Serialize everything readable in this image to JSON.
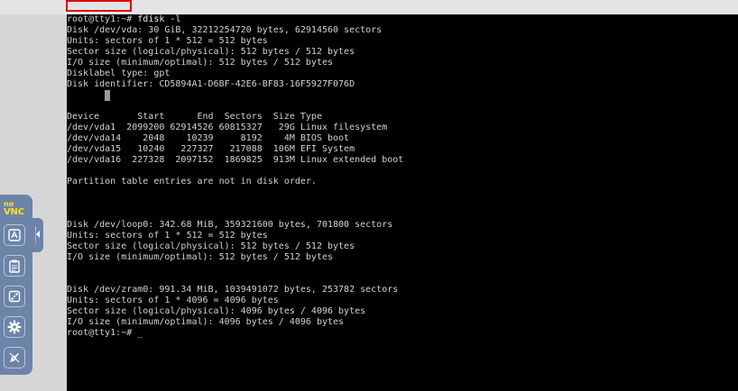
{
  "terminal": {
    "lines": [
      {
        "segments": [
          {
            "text": "root@tty1:",
            "cls": "prompt-user"
          },
          {
            "text": "~#",
            "cls": "prompt-tilde"
          },
          {
            "text": " fdisk -l",
            "cls": "cmd-text"
          }
        ]
      },
      {
        "segments": [
          {
            "text": "Disk /dev/vda: 30 GiB, 32212254720 bytes, 62914560 sectors"
          }
        ]
      },
      {
        "segments": [
          {
            "text": "Units: sectors of 1 * 512 = 512 bytes"
          }
        ]
      },
      {
        "segments": [
          {
            "text": "Sector size (logical/physical): 512 bytes / 512 bytes"
          }
        ]
      },
      {
        "segments": [
          {
            "text": "I/O size (minimum/optimal): 512 bytes / 512 bytes"
          }
        ]
      },
      {
        "segments": [
          {
            "text": "Disklabel type: gpt"
          }
        ]
      },
      {
        "segments": [
          {
            "text": "Disk identifier: CD5894A1-D6BF-42E6-BF83-16F5927F076D"
          }
        ]
      },
      {
        "segments": [
          {
            "text": ""
          }
        ]
      },
      {
        "segments": [
          {
            "text": ""
          }
        ]
      },
      {
        "segments": [
          {
            "text": "Device       Start      End  Sectors  Size Type"
          }
        ]
      },
      {
        "segments": [
          {
            "text": "/dev/vda1  2099200 62914526 60815327   29G Linux filesystem"
          }
        ]
      },
      {
        "segments": [
          {
            "text": "/dev/vda14    2048    10239     8192    4M BIOS boot"
          }
        ]
      },
      {
        "segments": [
          {
            "text": "/dev/vda15   10240   227327   217088  106M EFI System"
          }
        ]
      },
      {
        "segments": [
          {
            "text": "/dev/vda16  227328  2097152  1869825  913M Linux extended boot"
          }
        ]
      },
      {
        "segments": [
          {
            "text": ""
          }
        ]
      },
      {
        "segments": [
          {
            "text": "Partition table entries are not in disk order."
          }
        ]
      },
      {
        "segments": [
          {
            "text": ""
          }
        ]
      },
      {
        "segments": [
          {
            "text": ""
          }
        ]
      },
      {
        "segments": [
          {
            "text": ""
          }
        ]
      },
      {
        "segments": [
          {
            "text": "Disk /dev/loop0: 342.68 MiB, 359321600 bytes, 701800 sectors"
          }
        ]
      },
      {
        "segments": [
          {
            "text": "Units: sectors of 1 * 512 = 512 bytes"
          }
        ]
      },
      {
        "segments": [
          {
            "text": "Sector size (logical/physical): 512 bytes / 512 bytes"
          }
        ]
      },
      {
        "segments": [
          {
            "text": "I/O size (minimum/optimal): 512 bytes / 512 bytes"
          }
        ]
      },
      {
        "segments": [
          {
            "text": ""
          }
        ]
      },
      {
        "segments": [
          {
            "text": ""
          }
        ]
      },
      {
        "segments": [
          {
            "text": "Disk /dev/zram0: 991.34 MiB, 1039491072 bytes, 253782 sectors"
          }
        ]
      },
      {
        "segments": [
          {
            "text": "Units: sectors of 1 * 4096 = 4096 bytes"
          }
        ]
      },
      {
        "segments": [
          {
            "text": "Sector size (logical/physical): 4096 bytes / 4096 bytes"
          }
        ]
      },
      {
        "segments": [
          {
            "text": "I/O size (minimum/optimal): 4096 bytes / 4096 bytes"
          }
        ]
      },
      {
        "segments": [
          {
            "text": "root@tty1:",
            "cls": "prompt-user"
          },
          {
            "text": "~#",
            "cls": "prompt-tilde"
          },
          {
            "text": " _",
            "cls": "underscore-cursor"
          }
        ]
      }
    ]
  },
  "novnc": {
    "logo_top": "no",
    "logo_bottom": "VNC",
    "buttons": [
      {
        "name": "keyboard-button",
        "icon": "keyboard-icon"
      },
      {
        "name": "clipboard-button",
        "icon": "clipboard-icon"
      },
      {
        "name": "extra-keys-button",
        "icon": "dice-icon"
      },
      {
        "name": "settings-button",
        "icon": "gear-icon"
      },
      {
        "name": "disconnect-button",
        "icon": "disconnect-icon"
      }
    ]
  },
  "colors": {
    "terminal_bg": "#000000",
    "terminal_fg": "#d2d2d2",
    "highlight": "#e00000",
    "novnc_panel": "#6c84a8",
    "novnc_logo": "#ffe020"
  }
}
